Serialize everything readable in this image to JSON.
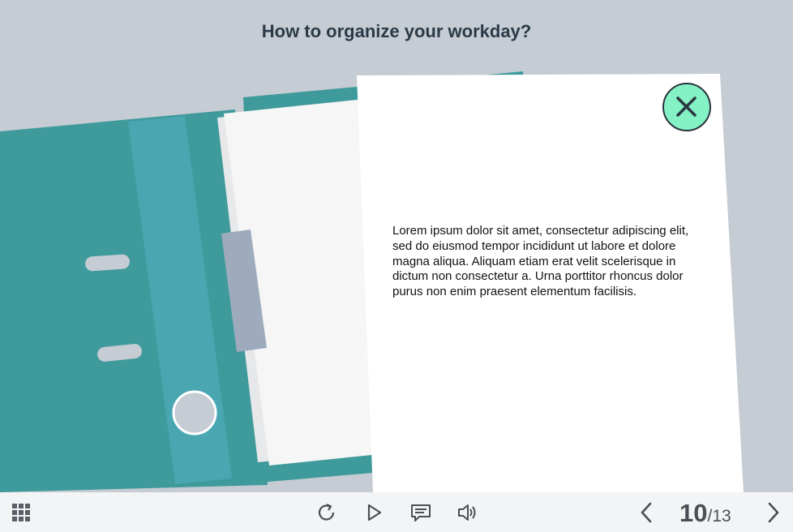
{
  "slide": {
    "title": "How to organize your workday?",
    "note_text": "Lorem ipsum dolor sit amet, consectetur adipiscing elit, sed do eiusmod tempor incididunt ut labore et dolore magna aliqua. Aliquam etiam erat velit scelerisque in dictum non consectetur a. Urna porttitor rhoncus dolor purus non enim praesent elementum facilisis.",
    "close_icon": "close-icon"
  },
  "toolbar": {
    "menu_icon": "grid-menu-icon",
    "replay_icon": "replay-icon",
    "play_icon": "play-icon",
    "captions_icon": "captions-icon",
    "volume_icon": "volume-icon",
    "prev_icon": "chevron-left-icon",
    "next_icon": "chevron-right-icon",
    "current_slide": "10",
    "separator_total": "/13"
  },
  "colors": {
    "background": "#c5ccd3",
    "binder": "#3f9a9b",
    "binder_spine": "#4aa7b2",
    "accent_close": "#84f2c4",
    "toolbar": "#f3f4f5",
    "title": "#2b3a47"
  }
}
